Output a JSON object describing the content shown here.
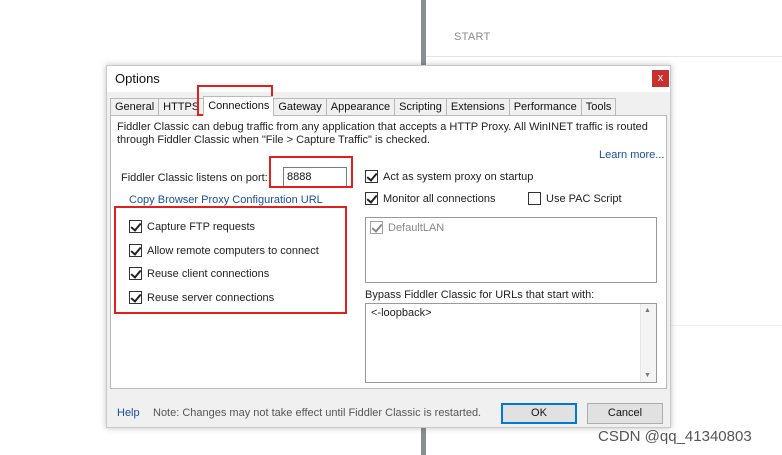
{
  "background": {
    "start_label": "START",
    "watermark": "CSDN @qq_41340803"
  },
  "dialog": {
    "title": "Options",
    "close_glyph": "x",
    "tabs": [
      {
        "label": "General"
      },
      {
        "label": "HTTPS"
      },
      {
        "label": "Connections",
        "active": true
      },
      {
        "label": "Gateway"
      },
      {
        "label": "Appearance"
      },
      {
        "label": "Scripting"
      },
      {
        "label": "Extensions"
      },
      {
        "label": "Performance"
      },
      {
        "label": "Tools"
      }
    ],
    "description": "Fiddler Classic can debug traffic from any application that accepts a HTTP Proxy. All WinINET traffic is routed through Fiddler Classic when \"File > Capture Traffic\" is checked.",
    "learn_more": "Learn more...",
    "port_label": "Fiddler Classic listens on port:",
    "port_value": "8888",
    "copy_link": "Copy Browser Proxy Configuration URL",
    "left_options": [
      {
        "label": "Capture FTP requests",
        "checked": true
      },
      {
        "label": "Allow remote computers to connect",
        "checked": true
      },
      {
        "label": "Reuse client connections",
        "checked": true
      },
      {
        "label": "Reuse server connections",
        "checked": true
      }
    ],
    "act_as_proxy": {
      "label": "Act as system proxy on startup",
      "checked": true
    },
    "monitor_all": {
      "label": "Monitor all connections",
      "checked": true
    },
    "use_pac": {
      "label": "Use PAC Script",
      "checked": false
    },
    "lan_list": [
      {
        "label": "DefaultLAN",
        "checked": true
      }
    ],
    "bypass_label": "Bypass Fiddler Classic for URLs that start with:",
    "bypass_value": "<-loopback>",
    "help": "Help",
    "note": "Note: Changes may not take effect until Fiddler Classic is restarted.",
    "ok": "OK",
    "cancel": "Cancel"
  },
  "highlight_color": "#e0201b",
  "accent_link_color": "#1a4fa0"
}
